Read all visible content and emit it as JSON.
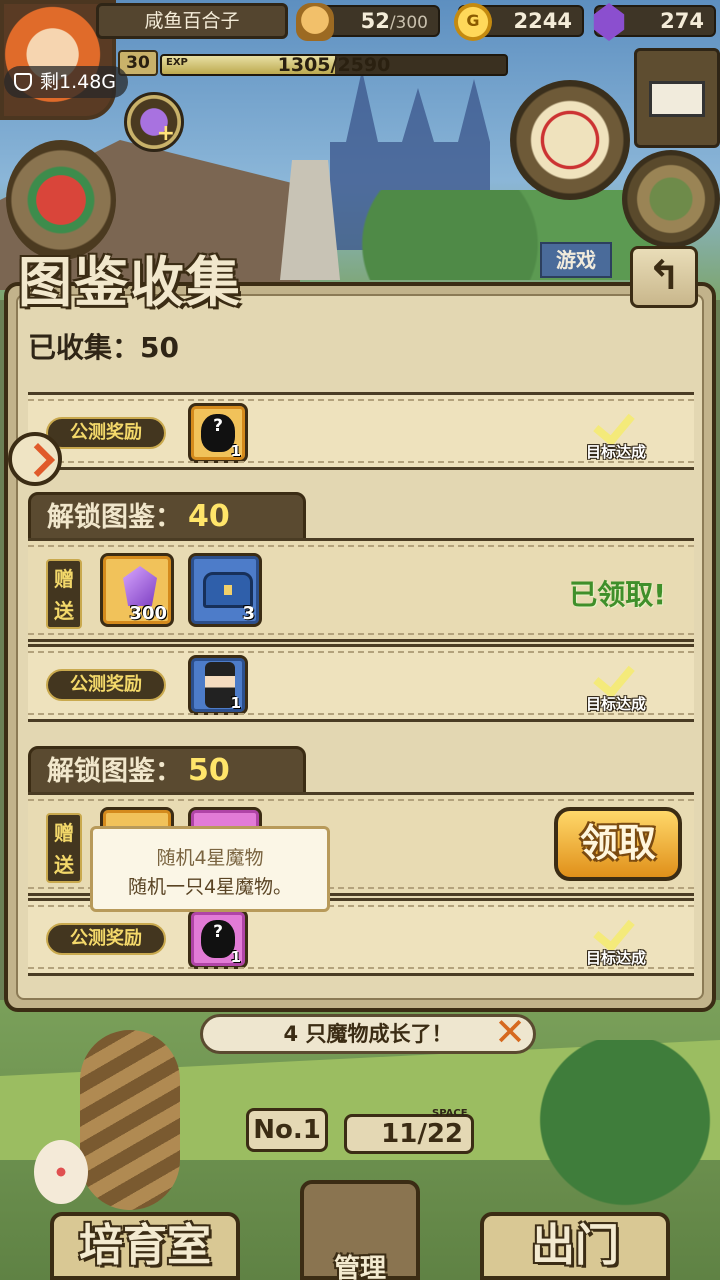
{
  "top": {
    "player_name": "咸鱼百合子",
    "level": "30",
    "exp_label": "EXP",
    "exp_text": "1305/2590",
    "exp_fraction": 0.504,
    "bread": "52",
    "bread_max": "/300",
    "gold": "2244",
    "gold_symbol": "G",
    "gems": "274",
    "data_remaining": "剩1.48G",
    "game_tag": "游戏"
  },
  "modal": {
    "title": "图鉴收集",
    "back_symbol": "↰",
    "collected_text": "已收集：50"
  },
  "row_top": {
    "beta_label": "公测奖励",
    "item_count": "1",
    "item_glyph": "?",
    "done_label": "目标达成"
  },
  "card_40": {
    "head_label": "解锁图鉴：",
    "head_num": "40",
    "gift_label": "赠送",
    "gem_count": "300",
    "chest_count": "3",
    "claimed_text": "已领取!",
    "beta_label": "公测奖励",
    "reward_count": "1",
    "done_label": "目标达成"
  },
  "card_50": {
    "head_label": "解锁图鉴：",
    "head_num": "50",
    "gift_label": "赠送",
    "claim_label": "领取",
    "beta_label": "公测奖励",
    "reward_count": "1",
    "reward_glyph": "?",
    "done_label": "目标达成"
  },
  "tooltip": {
    "title": "随机4星魔物",
    "desc": "随机一只4星魔物。"
  },
  "bottom": {
    "message": "4 只魔物成长了！",
    "close_symbol": "✕",
    "no_label": "No.1",
    "space_label": "SPACE",
    "space_value": "11/22",
    "nav_left": "培育室",
    "nav_mid": "管理",
    "nav_right": "出门"
  },
  "colors": {
    "panel": "#e3d7b2",
    "frame": "#3b2c14",
    "accent_yellow": "#ffe56a",
    "claimed_green": "#3f8f2a",
    "claim_button": "#e0901a"
  }
}
